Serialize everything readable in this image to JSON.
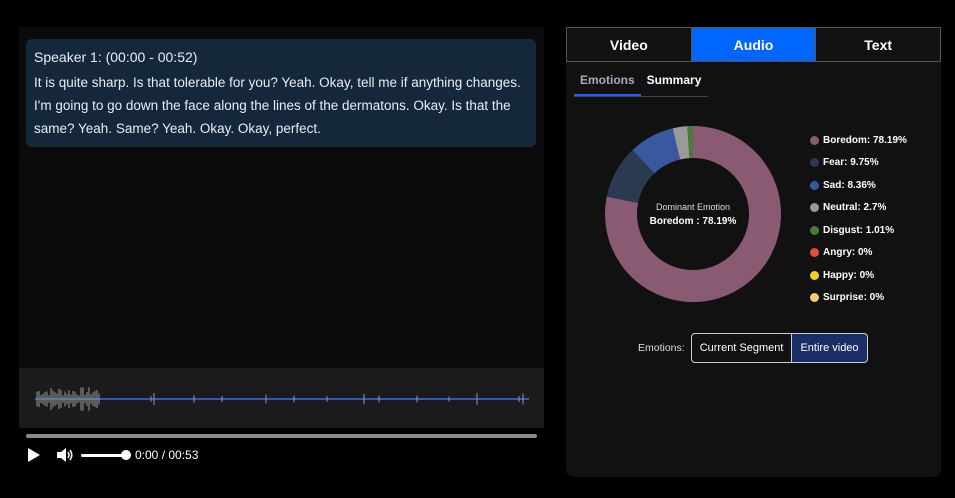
{
  "transcript": {
    "speaker": "Speaker 1: (00:00 - 00:52)",
    "text": "It is quite sharp. Is that tolerable for you? Yeah. Okay, tell me if anything changes. I'm going to go down the face along the lines of the dermatons. Okay. Is that the same? Yeah. Same? Yeah. Okay. Okay, perfect."
  },
  "player": {
    "time": "0:00 / 00:53",
    "progress": 0.0,
    "volume": 1.0
  },
  "tabs": [
    {
      "label": "Video",
      "active": false
    },
    {
      "label": "Audio",
      "active": true
    },
    {
      "label": "Text",
      "active": false
    }
  ],
  "subtabs": [
    {
      "label": "Emotions",
      "active": true
    },
    {
      "label": "Summary",
      "active": false
    }
  ],
  "chart_data": {
    "type": "pie",
    "categories": [
      "Boredom",
      "Fear",
      "Sad",
      "Neutral",
      "Disgust",
      "Angry",
      "Happy",
      "Surprise"
    ],
    "values": [
      78.19,
      9.75,
      8.36,
      2.7,
      1.01,
      0,
      0,
      0
    ],
    "legend_labels": [
      "Boredom: 78.19%",
      "Fear: 9.75%",
      "Sad: 8.36%",
      "Neutral: 2.7%",
      "Disgust: 1.01%",
      "Angry: 0%",
      "Happy: 0%",
      "Surprise: 0%"
    ],
    "colors": [
      "#8a5a73",
      "#2a3a50",
      "#3a58a0",
      "#9a9a9a",
      "#4d7a3a",
      "#e0503a",
      "#f0d020",
      "#f0d070"
    ],
    "center_label": "Dominant Emotion",
    "center_value": "Boredom : 78.19%",
    "legend": "right"
  },
  "segment": {
    "label": "Emotions:",
    "current": "Current Segment",
    "entire": "Entire video"
  }
}
